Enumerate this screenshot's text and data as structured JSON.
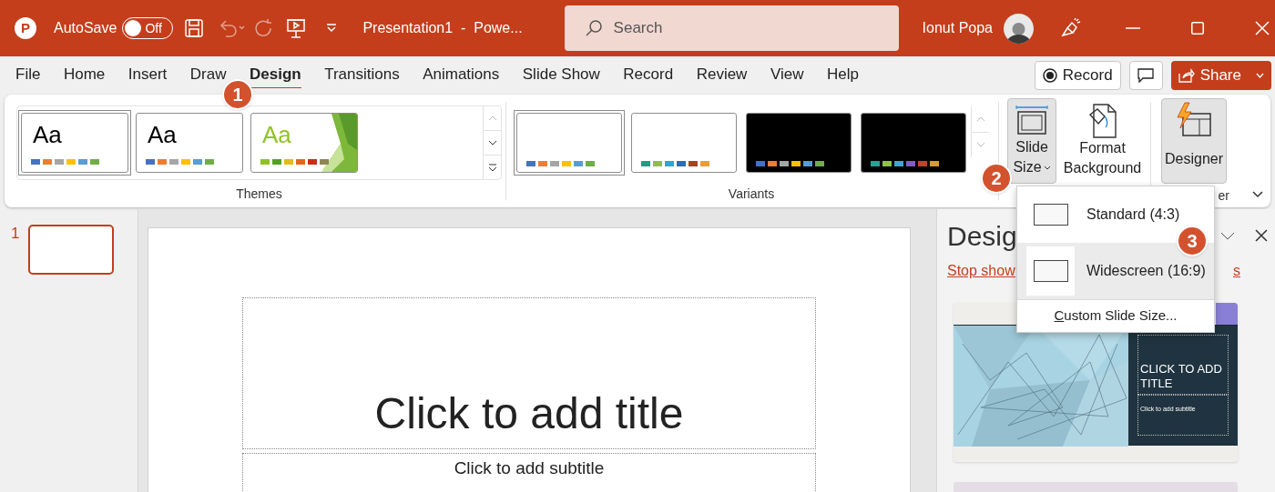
{
  "title_bar": {
    "app_logo_letter": "P",
    "autosave": {
      "label": "AutoSave",
      "on": false,
      "state_text": "Off"
    },
    "document_title": "Presentation1  -  Powe...",
    "search": {
      "placeholder": "Search"
    },
    "user_name": "Ionut Popa"
  },
  "menu_tabs": [
    {
      "label": "File",
      "selected": false
    },
    {
      "label": "Home",
      "selected": false
    },
    {
      "label": "Insert",
      "selected": false
    },
    {
      "label": "Draw",
      "selected": false
    },
    {
      "label": "Design",
      "selected": true
    },
    {
      "label": "Transitions",
      "selected": false
    },
    {
      "label": "Animations",
      "selected": false
    },
    {
      "label": "Slide Show",
      "selected": false
    },
    {
      "label": "Record",
      "selected": false
    },
    {
      "label": "Review",
      "selected": false
    },
    {
      "label": "View",
      "selected": false
    },
    {
      "label": "Help",
      "selected": false
    }
  ],
  "ribbon_actions": {
    "record": "Record",
    "share": "Share"
  },
  "themes": {
    "label": "Themes",
    "items": [
      {
        "sample": "Aa",
        "kind": "plain",
        "selected": true,
        "swatches": [
          {
            "color": "#4472c4"
          },
          {
            "color": "#ed7d31"
          },
          {
            "color": "#a5a5a5"
          },
          {
            "color": "#ffc000"
          },
          {
            "color": "#5b9bd5"
          },
          {
            "color": "#70ad47"
          }
        ]
      },
      {
        "sample": "Aa",
        "kind": "plain",
        "selected": false,
        "swatches": [
          {
            "color": "#4472c4"
          },
          {
            "color": "#ed7d31"
          },
          {
            "color": "#a5a5a5"
          },
          {
            "color": "#ffc000"
          },
          {
            "color": "#5b9bd5"
          },
          {
            "color": "#70ad47"
          }
        ]
      },
      {
        "sample": "Aa",
        "kind": "facet",
        "selected": false,
        "swatches": [
          {
            "color": "#90c226"
          },
          {
            "color": "#54a021"
          },
          {
            "color": "#e6b91e"
          },
          {
            "color": "#e76618"
          },
          {
            "color": "#c42f1a"
          },
          {
            "color": "#918655"
          }
        ]
      }
    ]
  },
  "variants": {
    "label": "Variants",
    "items": [
      {
        "selected": true,
        "kind": "light",
        "swatches": [
          {
            "color": "#4472c4"
          },
          {
            "color": "#ed7d31"
          },
          {
            "color": "#a5a5a5"
          },
          {
            "color": "#ffc000"
          },
          {
            "color": "#5b9bd5"
          },
          {
            "color": "#70ad47"
          }
        ]
      },
      {
        "selected": false,
        "kind": "light",
        "swatches": [
          {
            "color": "#1e9e83"
          },
          {
            "color": "#8cc04a"
          },
          {
            "color": "#2ca6d4"
          },
          {
            "color": "#2d6db2"
          },
          {
            "color": "#a8421c"
          },
          {
            "color": "#e8a02c"
          }
        ]
      },
      {
        "selected": false,
        "kind": "dark",
        "swatches": [
          {
            "color": "#4472c4"
          },
          {
            "color": "#ed7d31"
          },
          {
            "color": "#a5a5a5"
          },
          {
            "color": "#ffc000"
          },
          {
            "color": "#5b9bd5"
          },
          {
            "color": "#70ad47"
          }
        ]
      },
      {
        "selected": false,
        "kind": "dark",
        "swatches": [
          {
            "color": "#1fa592"
          },
          {
            "color": "#8cc340"
          },
          {
            "color": "#3aa7d9"
          },
          {
            "color": "#7f5fc0"
          },
          {
            "color": "#c2412e"
          },
          {
            "color": "#d89a34"
          }
        ]
      }
    ]
  },
  "customize": {
    "slide_size": {
      "lines": [
        "Slide",
        "Size"
      ],
      "pressed": true
    },
    "format_background": {
      "lines": [
        "Format",
        "Background"
      ]
    }
  },
  "designer": {
    "label": "Designer",
    "pressed": true,
    "group_label": "er"
  },
  "slide_size_menu": {
    "items": [
      {
        "label": "Standard (4:3)",
        "selected": false
      },
      {
        "label": "Widescreen (16:9)",
        "selected": true
      }
    ],
    "custom": "Custom Slide Size..."
  },
  "callouts": [
    "1",
    "2",
    "3"
  ],
  "slides_pane": {
    "slides": [
      {
        "number": "1",
        "selected": true
      }
    ]
  },
  "slide": {
    "title_placeholder": "Click to add title",
    "subtitle_placeholder": "Click to add subtitle"
  },
  "designer_pane": {
    "title": "Desig",
    "link_start": "Stop show",
    "link_end": "s",
    "ideas": [
      {
        "title": "CLICK TO ADD TITLE",
        "subtitle": "Click to add subtitle"
      }
    ]
  }
}
